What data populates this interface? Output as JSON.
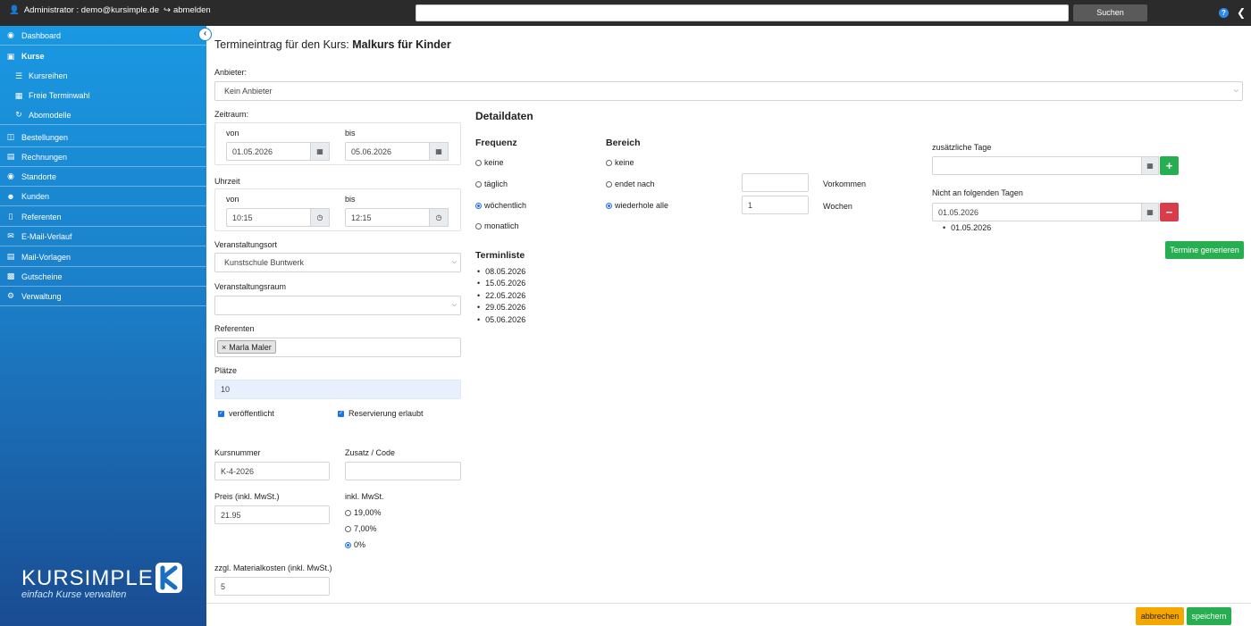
{
  "topbar": {
    "user_label": "Administrator : demo@kursimple.de",
    "logout_label": "abmelden",
    "search_placeholder": "",
    "search_button": "Suchen",
    "help_icon": "?"
  },
  "sidebar": {
    "items": [
      {
        "label": "Dashboard",
        "icon": "dashboard-icon"
      },
      {
        "label": "Kurse",
        "icon": "book-icon"
      },
      {
        "label": "Kursreihen",
        "icon": "list-icon"
      },
      {
        "label": "Freie Terminwahl",
        "icon": "calendar-icon"
      },
      {
        "label": "Abomodelle",
        "icon": "refresh-icon"
      },
      {
        "label": "Bestellungen",
        "icon": "cart-icon"
      },
      {
        "label": "Rechnungen",
        "icon": "invoice-icon"
      },
      {
        "label": "Standorte",
        "icon": "map-marker-icon"
      },
      {
        "label": "Kunden",
        "icon": "users-icon"
      },
      {
        "label": "Referenten",
        "icon": "id-card-icon"
      },
      {
        "label": "E-Mail-Verlauf",
        "icon": "envelope-icon"
      },
      {
        "label": "Mail-Vorlagen",
        "icon": "file-icon"
      },
      {
        "label": "Gutscheine",
        "icon": "gift-icon"
      },
      {
        "label": "Verwaltung",
        "icon": "gear-icon"
      }
    ],
    "logo_title": "KURSIMPLE",
    "logo_tagline": "einfach Kurse verwalten"
  },
  "page": {
    "title_prefix": "Termineintrag für den Kurs:",
    "title_course": "Malkurs für Kinder"
  },
  "form": {
    "anbieter_label": "Anbieter:",
    "anbieter_value": "Kein Anbieter",
    "zeitraum_label": "Zeitraum:",
    "von_label": "von",
    "bis_label": "bis",
    "zeitraum_von": "01.05.2026",
    "zeitraum_bis": "05.06.2026",
    "uhrzeit_label": "Uhrzeit",
    "uhrzeit_von": "10:15",
    "uhrzeit_bis": "12:15",
    "ort_label": "Veranstaltungsort",
    "ort_value": "Kunstschule Buntwerk",
    "raum_label": "Veranstaltungsraum",
    "raum_value": "",
    "referenten_label": "Referenten",
    "referent_tag": "Marla Maler",
    "referent_tag_remove": "×",
    "plaetze_label": "Plätze",
    "plaetze_value": "10",
    "veroeffentlicht_label": "veröffentlicht",
    "reservierung_label": "Reservierung erlaubt",
    "kursnummer_label": "Kursnummer",
    "kursnummer_value": "K-4-2026",
    "zusatz_label": "Zusatz / Code",
    "zusatz_value": "",
    "preis_label": "Preis (inkl. MwSt.)",
    "preis_value": "21.95",
    "mwst_label": "inkl. MwSt.",
    "mwst_options": [
      "19,00%",
      "7,00%",
      "0%"
    ],
    "material_label": "zzgl. Materialkosten (inkl. MwSt.)",
    "material_value": "5"
  },
  "detail": {
    "heading": "Detaildaten",
    "frequenz_heading": "Frequenz",
    "frequenz_options": [
      "keine",
      "täglich",
      "wöchentlich",
      "monatlich"
    ],
    "bereich_heading": "Bereich",
    "bereich_keine": "keine",
    "bereich_endet": "endet nach",
    "bereich_wiederhole": "wiederhole alle",
    "endet_value": "",
    "vorkommen_label": "Vorkommen",
    "wiederhole_value": "1",
    "wochen_label": "Wochen",
    "terminliste_heading": "Terminliste",
    "termine": [
      "08.05.2026",
      "15.05.2026",
      "22.05.2026",
      "29.05.2026",
      "05.06.2026"
    ],
    "zusaetzliche_label": "zusätzliche Tage",
    "zusaetzliche_value": "",
    "plus_label": "+",
    "nicht_label": "Nicht an folgenden Tagen",
    "nicht_value": "01.05.2026",
    "minus_label": "−",
    "nicht_list": [
      "01.05.2026"
    ],
    "generieren_button": "Termine generieren"
  },
  "footer": {
    "abbrechen": "abbrechen",
    "speichern": "speichern"
  },
  "colors": {
    "accent_green": "#27ae50",
    "accent_red": "#d93d4a",
    "accent_orange": "#f5a700",
    "sidebar_blue": "#1a98e2"
  }
}
